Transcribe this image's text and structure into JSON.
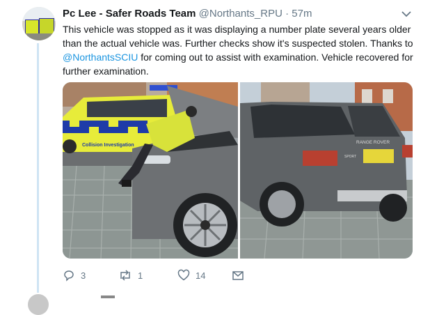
{
  "tweet": {
    "author_name": "Pc Lee - Safer Roads Team",
    "handle": "@Northants_RPU",
    "separator": "·",
    "time": "57m",
    "text_part1": "This vehicle was stopped as it was displaying a number plate several years older than the actual vehicle was. Further checks show it's suspected stolen. Thanks to",
    "mention": "@NorthantsSCIU",
    "text_part2": "for coming out to assist with examination. Vehicle recovered for further examination."
  },
  "media": {
    "photo1": {
      "vehicle_livery_text": "Collision Investigation"
    },
    "photo2": {
      "badge_text": "RANGE ROVER",
      "model_text": "SPORT"
    }
  },
  "actions": {
    "reply_count": "3",
    "retweet_count": "1",
    "like_count": "14"
  },
  "colors": {
    "accent": "#1b95e0",
    "text": "#14171a",
    "muted": "#657786",
    "thread_line": "#cfe4f4"
  },
  "icons": {
    "header_menu": "chevron-down-icon",
    "reply": "reply-icon",
    "retweet": "retweet-icon",
    "like": "heart-icon",
    "dm": "envelope-icon"
  }
}
